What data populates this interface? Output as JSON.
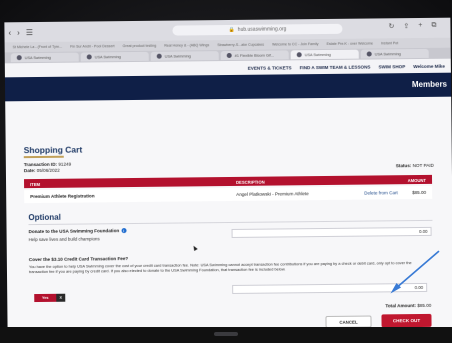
{
  "browser": {
    "url": "hub.usaswimming.org",
    "bookmarks": [
      "St Michele La - (Front of Tyre...",
      "Fin Sur Andri - Pool Dessert",
      "Great product testing",
      "Real Honey & - (ABQ Wings",
      "Strawberry-S...ake Cupcakes",
      "Welcome to CC - Join Family",
      "Estate Pre-K - over Welcome",
      "Instant Pot"
    ],
    "tabs": [
      "USA Swimming",
      "USA Swimming",
      "USA Swimming",
      "#1 Flexible Bloom Gif...",
      "USA Swimming",
      "USA Swimming"
    ]
  },
  "site_nav": {
    "items": [
      "EVENTS & TICKETS",
      "FIND A SWIM TEAM & LESSONS",
      "SWIM SHOP",
      "Welcome Mike"
    ],
    "banner": "Members"
  },
  "cart": {
    "title": "Shopping Cart",
    "transaction_label": "Transaction ID:",
    "transaction_id": "91249",
    "date_label": "Date:",
    "date": "05/06/2022",
    "status_label": "Status:",
    "status": "NOT PAID",
    "columns": {
      "item": "ITEM",
      "description": "DESCRIPTION",
      "amount": "AMOUNT"
    },
    "row": {
      "item": "Premium Athlete Registration",
      "description": "Angel Platkowski - Premium Athlete",
      "action": "Delete from Cart",
      "amount": "$85.00"
    }
  },
  "optional": {
    "heading": "Optional",
    "donate_label": "Donate to the USA Swimming Foundation",
    "donate_sub": "Help save lives and build champions",
    "donate_value": "0.00",
    "fee_title": "Cover the $3.10 Credit Card Transaction Fee?",
    "fee_desc": "You have the option to help USA Swimming cover the cost of your credit card transaction fee. Note: USA Swimming cannot accept transaction fee contributions if you are paying by a check or debit card, only opt to cover the transaction fee if you are paying by credit card. If you also elected to donate to the USA Swimming Foundation, that transaction fee is included below.",
    "yes_label": "Yes",
    "no_label": "X",
    "fee_value": "0.00"
  },
  "checkout": {
    "total_label": "Total Amount:",
    "total": "$85.00",
    "cancel_label": "CANCEL",
    "checkout_label": "CHECK OUT"
  },
  "colors": {
    "brand_red": "#b3112e",
    "navy": "#0f1f47",
    "arrow": "#3a7bd5"
  }
}
